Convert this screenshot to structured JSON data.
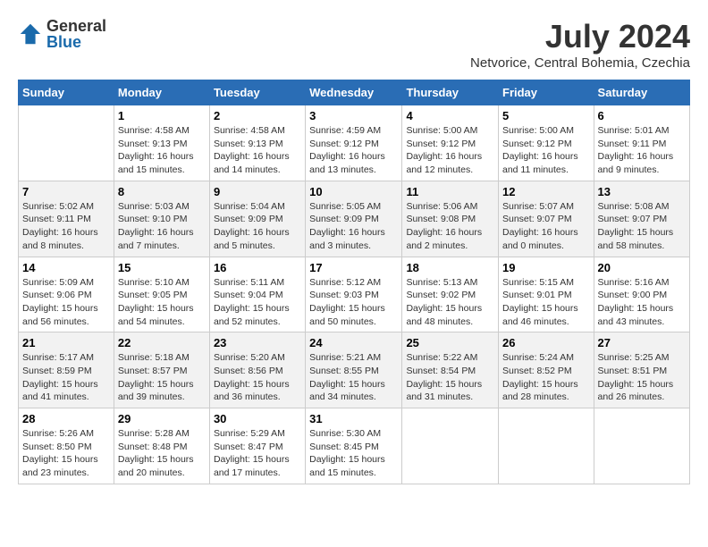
{
  "header": {
    "logo": {
      "general": "General",
      "blue": "Blue"
    },
    "title": "July 2024",
    "location": "Netvorice, Central Bohemia, Czechia"
  },
  "days_of_week": [
    "Sunday",
    "Monday",
    "Tuesday",
    "Wednesday",
    "Thursday",
    "Friday",
    "Saturday"
  ],
  "weeks": [
    [
      {
        "num": "",
        "info": ""
      },
      {
        "num": "1",
        "info": "Sunrise: 4:58 AM\nSunset: 9:13 PM\nDaylight: 16 hours\nand 15 minutes."
      },
      {
        "num": "2",
        "info": "Sunrise: 4:58 AM\nSunset: 9:13 PM\nDaylight: 16 hours\nand 14 minutes."
      },
      {
        "num": "3",
        "info": "Sunrise: 4:59 AM\nSunset: 9:12 PM\nDaylight: 16 hours\nand 13 minutes."
      },
      {
        "num": "4",
        "info": "Sunrise: 5:00 AM\nSunset: 9:12 PM\nDaylight: 16 hours\nand 12 minutes."
      },
      {
        "num": "5",
        "info": "Sunrise: 5:00 AM\nSunset: 9:12 PM\nDaylight: 16 hours\nand 11 minutes."
      },
      {
        "num": "6",
        "info": "Sunrise: 5:01 AM\nSunset: 9:11 PM\nDaylight: 16 hours\nand 9 minutes."
      }
    ],
    [
      {
        "num": "7",
        "info": "Sunrise: 5:02 AM\nSunset: 9:11 PM\nDaylight: 16 hours\nand 8 minutes."
      },
      {
        "num": "8",
        "info": "Sunrise: 5:03 AM\nSunset: 9:10 PM\nDaylight: 16 hours\nand 7 minutes."
      },
      {
        "num": "9",
        "info": "Sunrise: 5:04 AM\nSunset: 9:09 PM\nDaylight: 16 hours\nand 5 minutes."
      },
      {
        "num": "10",
        "info": "Sunrise: 5:05 AM\nSunset: 9:09 PM\nDaylight: 16 hours\nand 3 minutes."
      },
      {
        "num": "11",
        "info": "Sunrise: 5:06 AM\nSunset: 9:08 PM\nDaylight: 16 hours\nand 2 minutes."
      },
      {
        "num": "12",
        "info": "Sunrise: 5:07 AM\nSunset: 9:07 PM\nDaylight: 16 hours\nand 0 minutes."
      },
      {
        "num": "13",
        "info": "Sunrise: 5:08 AM\nSunset: 9:07 PM\nDaylight: 15 hours\nand 58 minutes."
      }
    ],
    [
      {
        "num": "14",
        "info": "Sunrise: 5:09 AM\nSunset: 9:06 PM\nDaylight: 15 hours\nand 56 minutes."
      },
      {
        "num": "15",
        "info": "Sunrise: 5:10 AM\nSunset: 9:05 PM\nDaylight: 15 hours\nand 54 minutes."
      },
      {
        "num": "16",
        "info": "Sunrise: 5:11 AM\nSunset: 9:04 PM\nDaylight: 15 hours\nand 52 minutes."
      },
      {
        "num": "17",
        "info": "Sunrise: 5:12 AM\nSunset: 9:03 PM\nDaylight: 15 hours\nand 50 minutes."
      },
      {
        "num": "18",
        "info": "Sunrise: 5:13 AM\nSunset: 9:02 PM\nDaylight: 15 hours\nand 48 minutes."
      },
      {
        "num": "19",
        "info": "Sunrise: 5:15 AM\nSunset: 9:01 PM\nDaylight: 15 hours\nand 46 minutes."
      },
      {
        "num": "20",
        "info": "Sunrise: 5:16 AM\nSunset: 9:00 PM\nDaylight: 15 hours\nand 43 minutes."
      }
    ],
    [
      {
        "num": "21",
        "info": "Sunrise: 5:17 AM\nSunset: 8:59 PM\nDaylight: 15 hours\nand 41 minutes."
      },
      {
        "num": "22",
        "info": "Sunrise: 5:18 AM\nSunset: 8:57 PM\nDaylight: 15 hours\nand 39 minutes."
      },
      {
        "num": "23",
        "info": "Sunrise: 5:20 AM\nSunset: 8:56 PM\nDaylight: 15 hours\nand 36 minutes."
      },
      {
        "num": "24",
        "info": "Sunrise: 5:21 AM\nSunset: 8:55 PM\nDaylight: 15 hours\nand 34 minutes."
      },
      {
        "num": "25",
        "info": "Sunrise: 5:22 AM\nSunset: 8:54 PM\nDaylight: 15 hours\nand 31 minutes."
      },
      {
        "num": "26",
        "info": "Sunrise: 5:24 AM\nSunset: 8:52 PM\nDaylight: 15 hours\nand 28 minutes."
      },
      {
        "num": "27",
        "info": "Sunrise: 5:25 AM\nSunset: 8:51 PM\nDaylight: 15 hours\nand 26 minutes."
      }
    ],
    [
      {
        "num": "28",
        "info": "Sunrise: 5:26 AM\nSunset: 8:50 PM\nDaylight: 15 hours\nand 23 minutes."
      },
      {
        "num": "29",
        "info": "Sunrise: 5:28 AM\nSunset: 8:48 PM\nDaylight: 15 hours\nand 20 minutes."
      },
      {
        "num": "30",
        "info": "Sunrise: 5:29 AM\nSunset: 8:47 PM\nDaylight: 15 hours\nand 17 minutes."
      },
      {
        "num": "31",
        "info": "Sunrise: 5:30 AM\nSunset: 8:45 PM\nDaylight: 15 hours\nand 15 minutes."
      },
      {
        "num": "",
        "info": ""
      },
      {
        "num": "",
        "info": ""
      },
      {
        "num": "",
        "info": ""
      }
    ]
  ]
}
